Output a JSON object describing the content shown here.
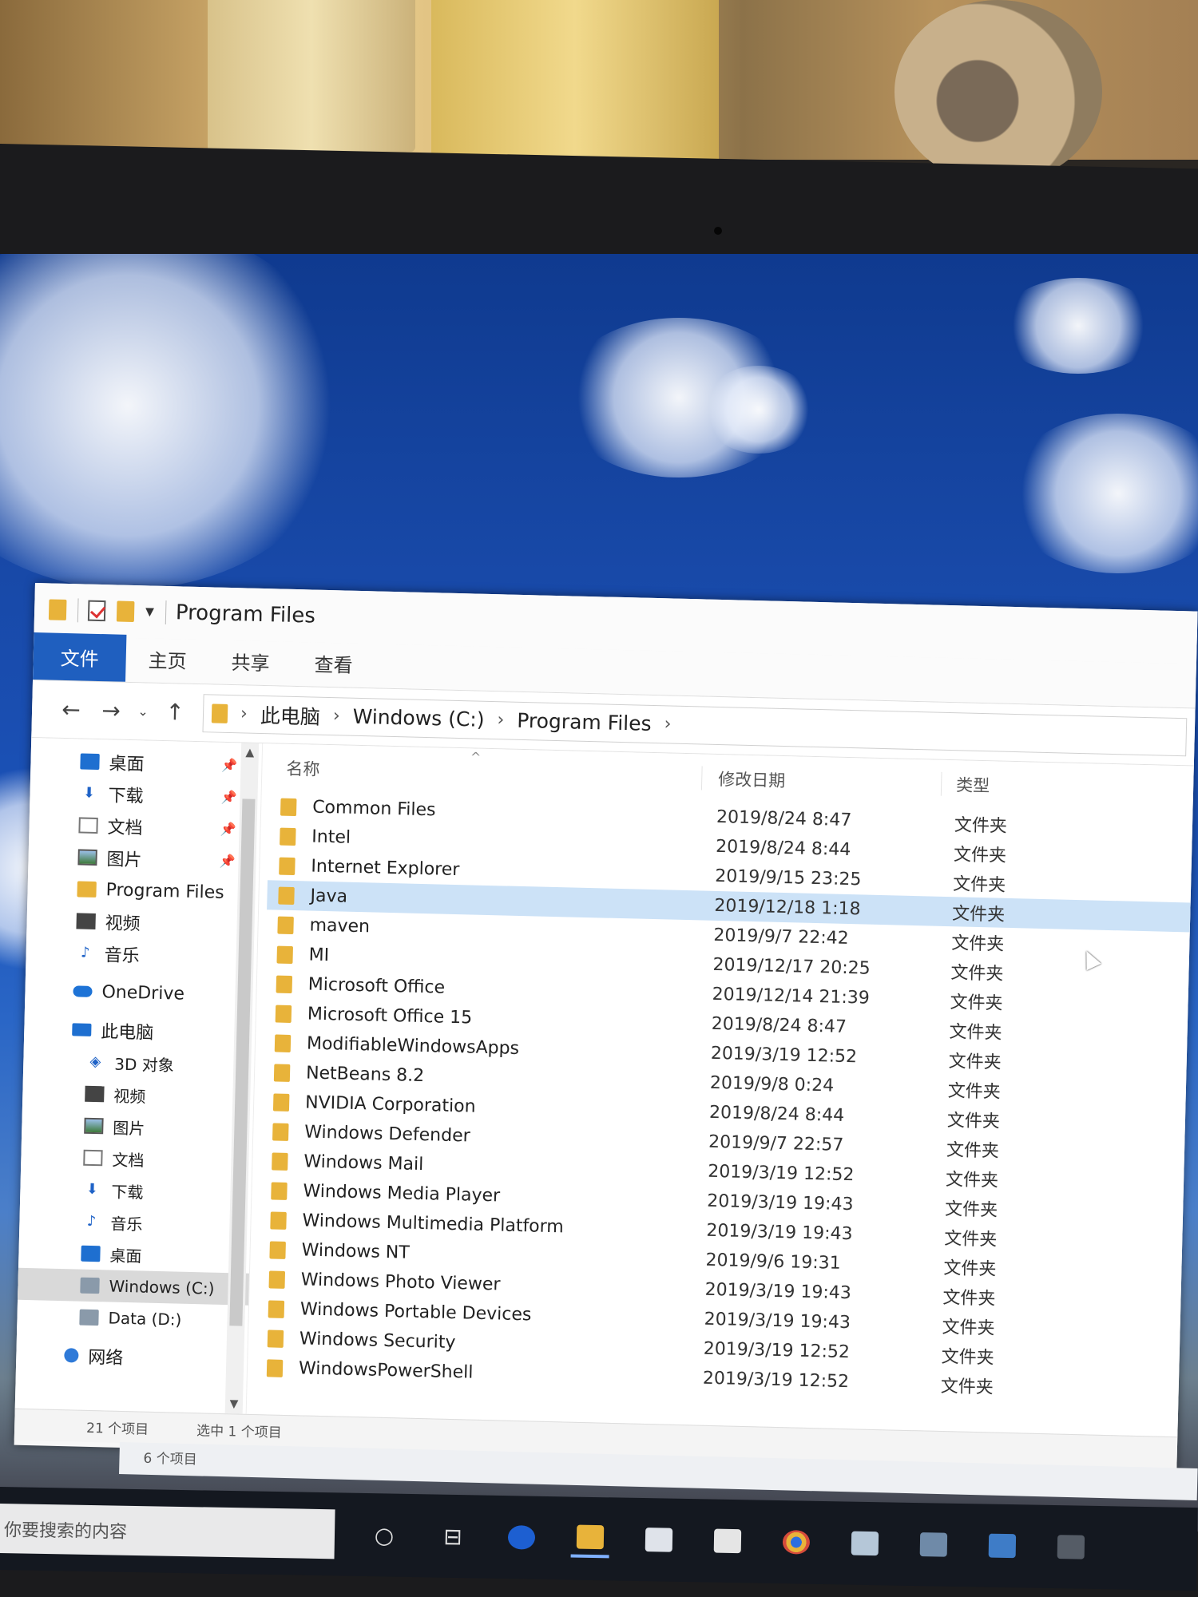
{
  "window": {
    "title": "Program Files"
  },
  "ribbon": {
    "tabs": [
      {
        "label": "文件",
        "active": true
      },
      {
        "label": "主页",
        "active": false
      },
      {
        "label": "共享",
        "active": false
      },
      {
        "label": "查看",
        "active": false
      }
    ]
  },
  "address": {
    "crumbs": [
      "此电脑",
      "Windows (C:)",
      "Program Files"
    ]
  },
  "nav": {
    "quick_access": [
      {
        "label": "桌面",
        "icon": "desktop-icon",
        "pinned": true
      },
      {
        "label": "下载",
        "icon": "download-icon",
        "pinned": true
      },
      {
        "label": "文档",
        "icon": "document-icon",
        "pinned": true
      },
      {
        "label": "图片",
        "icon": "picture-icon",
        "pinned": true
      },
      {
        "label": "Program Files",
        "icon": "folder-icon",
        "pinned": false
      },
      {
        "label": "视频",
        "icon": "video-icon",
        "pinned": false
      },
      {
        "label": "音乐",
        "icon": "music-icon",
        "pinned": false
      }
    ],
    "onedrive": "OneDrive",
    "this_pc": "此电脑",
    "pc_items": [
      {
        "label": "3D 对象",
        "icon": "3d-objects-icon"
      },
      {
        "label": "视频",
        "icon": "video-icon"
      },
      {
        "label": "图片",
        "icon": "picture-icon"
      },
      {
        "label": "文档",
        "icon": "document-icon"
      },
      {
        "label": "下载",
        "icon": "download-icon"
      },
      {
        "label": "音乐",
        "icon": "music-icon"
      },
      {
        "label": "桌面",
        "icon": "desktop-icon"
      },
      {
        "label": "Windows (C:)",
        "icon": "drive-icon",
        "selected": true
      },
      {
        "label": "Data (D:)",
        "icon": "drive-icon"
      }
    ],
    "network": "网络"
  },
  "list": {
    "columns": {
      "name": "名称",
      "date": "修改日期",
      "type": "类型"
    },
    "rows": [
      {
        "name": "Common Files",
        "date": "2019/8/24 8:47",
        "type": "文件夹"
      },
      {
        "name": "Intel",
        "date": "2019/8/24 8:44",
        "type": "文件夹"
      },
      {
        "name": "Internet Explorer",
        "date": "2019/9/15 23:25",
        "type": "文件夹"
      },
      {
        "name": "Java",
        "date": "2019/12/18 1:18",
        "type": "文件夹",
        "selected": true
      },
      {
        "name": "maven",
        "date": "2019/9/7 22:42",
        "type": "文件夹"
      },
      {
        "name": "MI",
        "date": "2019/12/17 20:25",
        "type": "文件夹"
      },
      {
        "name": "Microsoft Office",
        "date": "2019/12/14 21:39",
        "type": "文件夹"
      },
      {
        "name": "Microsoft Office 15",
        "date": "2019/8/24 8:47",
        "type": "文件夹"
      },
      {
        "name": "ModifiableWindowsApps",
        "date": "2019/3/19 12:52",
        "type": "文件夹"
      },
      {
        "name": "NetBeans 8.2",
        "date": "2019/9/8 0:24",
        "type": "文件夹"
      },
      {
        "name": "NVIDIA Corporation",
        "date": "2019/8/24 8:44",
        "type": "文件夹"
      },
      {
        "name": "Windows Defender",
        "date": "2019/9/7 22:57",
        "type": "文件夹"
      },
      {
        "name": "Windows Mail",
        "date": "2019/3/19 12:52",
        "type": "文件夹"
      },
      {
        "name": "Windows Media Player",
        "date": "2019/3/19 19:43",
        "type": "文件夹"
      },
      {
        "name": "Windows Multimedia Platform",
        "date": "2019/3/19 19:43",
        "type": "文件夹"
      },
      {
        "name": "Windows NT",
        "date": "2019/9/6 19:31",
        "type": "文件夹"
      },
      {
        "name": "Windows Photo Viewer",
        "date": "2019/3/19 19:43",
        "type": "文件夹"
      },
      {
        "name": "Windows Portable Devices",
        "date": "2019/3/19 19:43",
        "type": "文件夹"
      },
      {
        "name": "Windows Security",
        "date": "2019/3/19 12:52",
        "type": "文件夹"
      },
      {
        "name": "WindowsPowerShell",
        "date": "2019/3/19 12:52",
        "type": "文件夹"
      }
    ]
  },
  "status": {
    "count": "21 个项目",
    "selected": "选中 1 个项目"
  },
  "second_window_status": "6 个项目",
  "taskbar": {
    "search_placeholder": "你要搜索的内容"
  }
}
